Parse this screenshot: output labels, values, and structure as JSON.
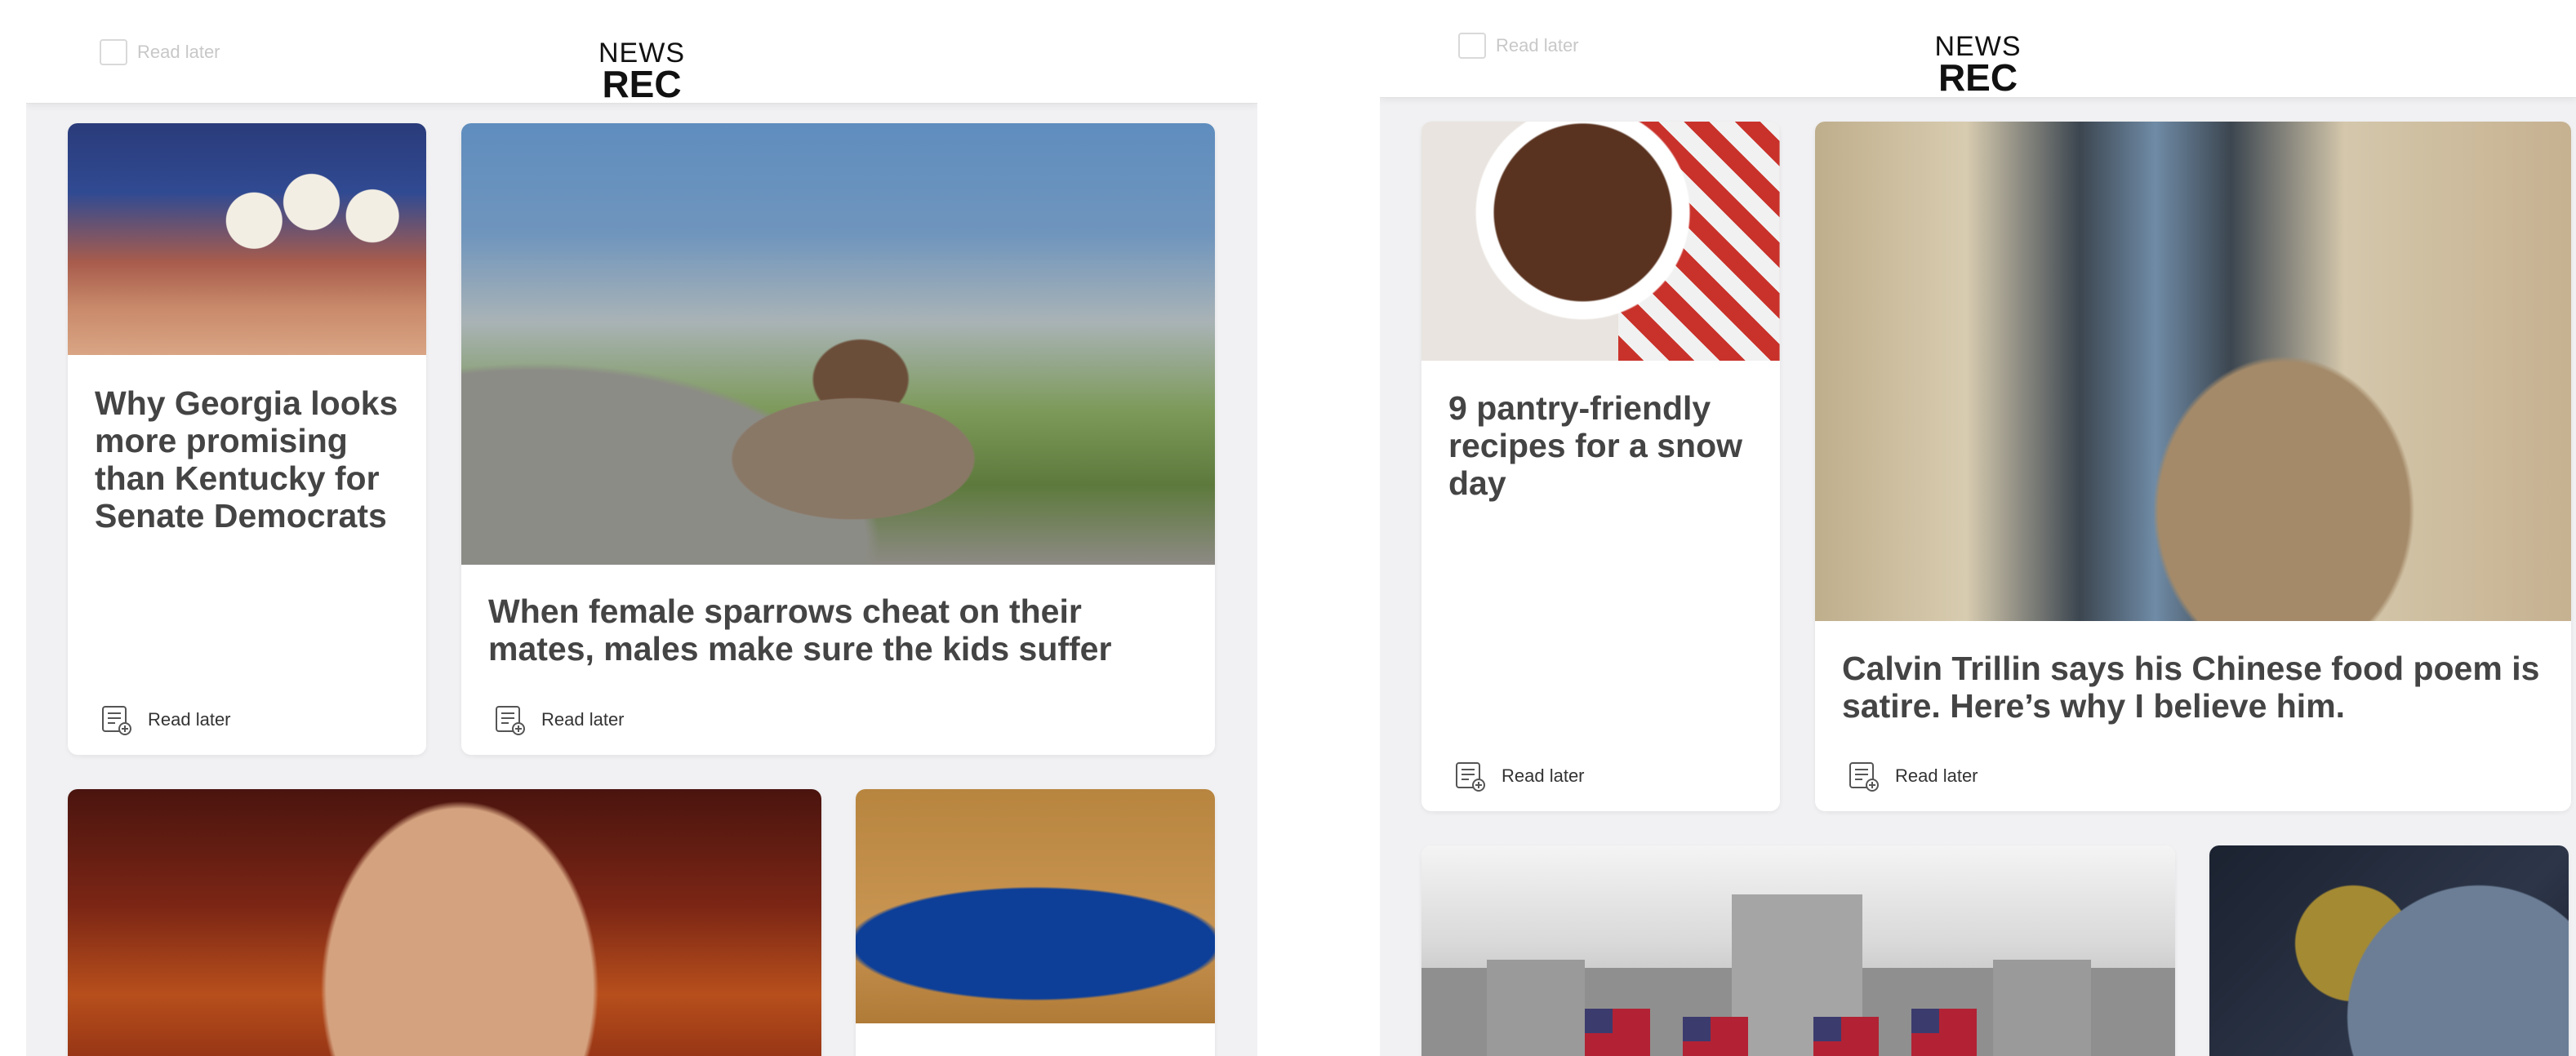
{
  "left_screen": {
    "logo": {
      "top": "NEWS",
      "bottom": "REC"
    },
    "ghost_read_later": "Read later",
    "cards": [
      {
        "title": "Why Georgia looks more promising than Kentucky for Senate Democrats",
        "read_later": "Read later",
        "image": "campaign-rally-photo"
      },
      {
        "title": "When female sparrows cheat on their mates, males make sure the kids suffer",
        "read_later": "Read later",
        "image": "sparrow-photo"
      },
      {
        "title": "",
        "image": "man-portrait-photo"
      },
      {
        "title": "",
        "image": "basketball-court-photo"
      }
    ]
  },
  "right_screen": {
    "logo": {
      "top": "NEWS",
      "bottom": "REC"
    },
    "ghost_read_later": "Read later",
    "cards": [
      {
        "title": "9 pantry-friendly recipes for a snow day",
        "read_later": "Read later",
        "image": "hot-cocoa-photo"
      },
      {
        "title": "Calvin Trillin says his Chinese food poem is satire. Here’s why I believe him.",
        "read_later": "Read later",
        "image": "office-writer-photo"
      },
      {
        "title": "",
        "image": "building-flags-photo"
      },
      {
        "title": "",
        "image": "space-planet-photo"
      }
    ]
  },
  "colors": {
    "background": "#f1f1f3",
    "card": "#ffffff",
    "title_text": "#444444",
    "logo": "#111111"
  }
}
